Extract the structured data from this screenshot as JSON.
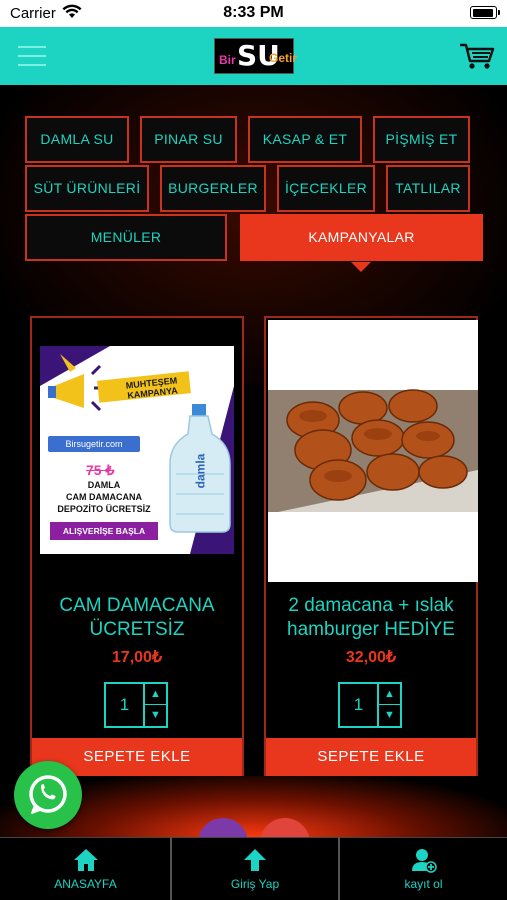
{
  "status_bar": {
    "carrier": "Carrier",
    "time": "8:33 PM"
  },
  "header": {
    "logo": {
      "bir": "Bir",
      "su": "SU",
      "getir": "Getir"
    },
    "brand_color": "#1dd3c1"
  },
  "categories": [
    {
      "label": "DAMLA SU"
    },
    {
      "label": "PINAR SU"
    },
    {
      "label": "KASAP & ET"
    },
    {
      "label": "PİŞMİŞ ET"
    },
    {
      "label": "SÜT ÜRÜNLERİ"
    },
    {
      "label": "BURGERLER"
    },
    {
      "label": "İÇECEKLER"
    },
    {
      "label": "TATLILAR"
    },
    {
      "label": "MENÜLER"
    },
    {
      "label": "KAMPANYALAR",
      "active": true
    }
  ],
  "products": [
    {
      "name": "CAM DAMACANA ÜCRETSİZ",
      "price": "17,00₺",
      "quantity": "1",
      "add_label": "SEPETE EKLE",
      "image_text": {
        "banner": "MUHTEŞEM KAMPANYA",
        "site": "Birsugetir.com",
        "old_price": "75 ₺",
        "line1": "DAMLA",
        "line2": "CAM DAMACANA",
        "line3": "DEPOZİTO ÜCRETSİZ",
        "cta": "ALIŞVERİŞE BAŞLA",
        "bottle_brand": "damla"
      }
    },
    {
      "name": "2 damacana + ıslak hamburger HEDİYE",
      "price": "32,00₺",
      "quantity": "1",
      "add_label": "SEPETE EKLE"
    }
  ],
  "tabbar": [
    {
      "label": "ANASAYFA",
      "icon": "home-icon"
    },
    {
      "label": "Giriş Yap",
      "icon": "arrow-up-icon"
    },
    {
      "label": "kayıt ol",
      "icon": "add-user-icon"
    }
  ],
  "colors": {
    "accent": "#e8371d",
    "teal": "#1dd3c1",
    "whatsapp": "#28c24a"
  }
}
